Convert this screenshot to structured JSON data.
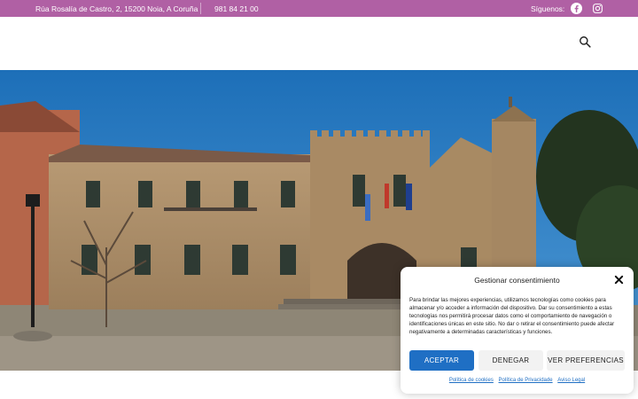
{
  "topbar": {
    "address": "Rúa Rosalía de Castro, 2, 15200 Noia, A Coruña",
    "phone": "981 84 21 00",
    "follow_label": "Síguenos:",
    "social": [
      "facebook-icon",
      "instagram-icon"
    ],
    "bg_color": "#b060a4"
  },
  "header": {
    "search_icon": "search-icon"
  },
  "consent": {
    "title": "Gestionar consentimiento",
    "text": "Para brindar las mejores experiencias, utilizamos tecnologías como cookies para almacenar y/o acceder a información del dispositivo. Dar su consentimiento a estas tecnologías nos permitirá procesar datos como el comportamiento de navegación o identificaciones únicas en este sitio. No dar o retirar el consentimiento puede afectar negativamente a determinadas características y funciones.",
    "accept": "ACEPTAR",
    "deny": "DENEGAR",
    "preferences": "VER PREFERENCIAS",
    "links": [
      "Política de cookies",
      "Política de Privacidade",
      "Aviso Legal"
    ],
    "accent_color": "#1f6fc4"
  }
}
